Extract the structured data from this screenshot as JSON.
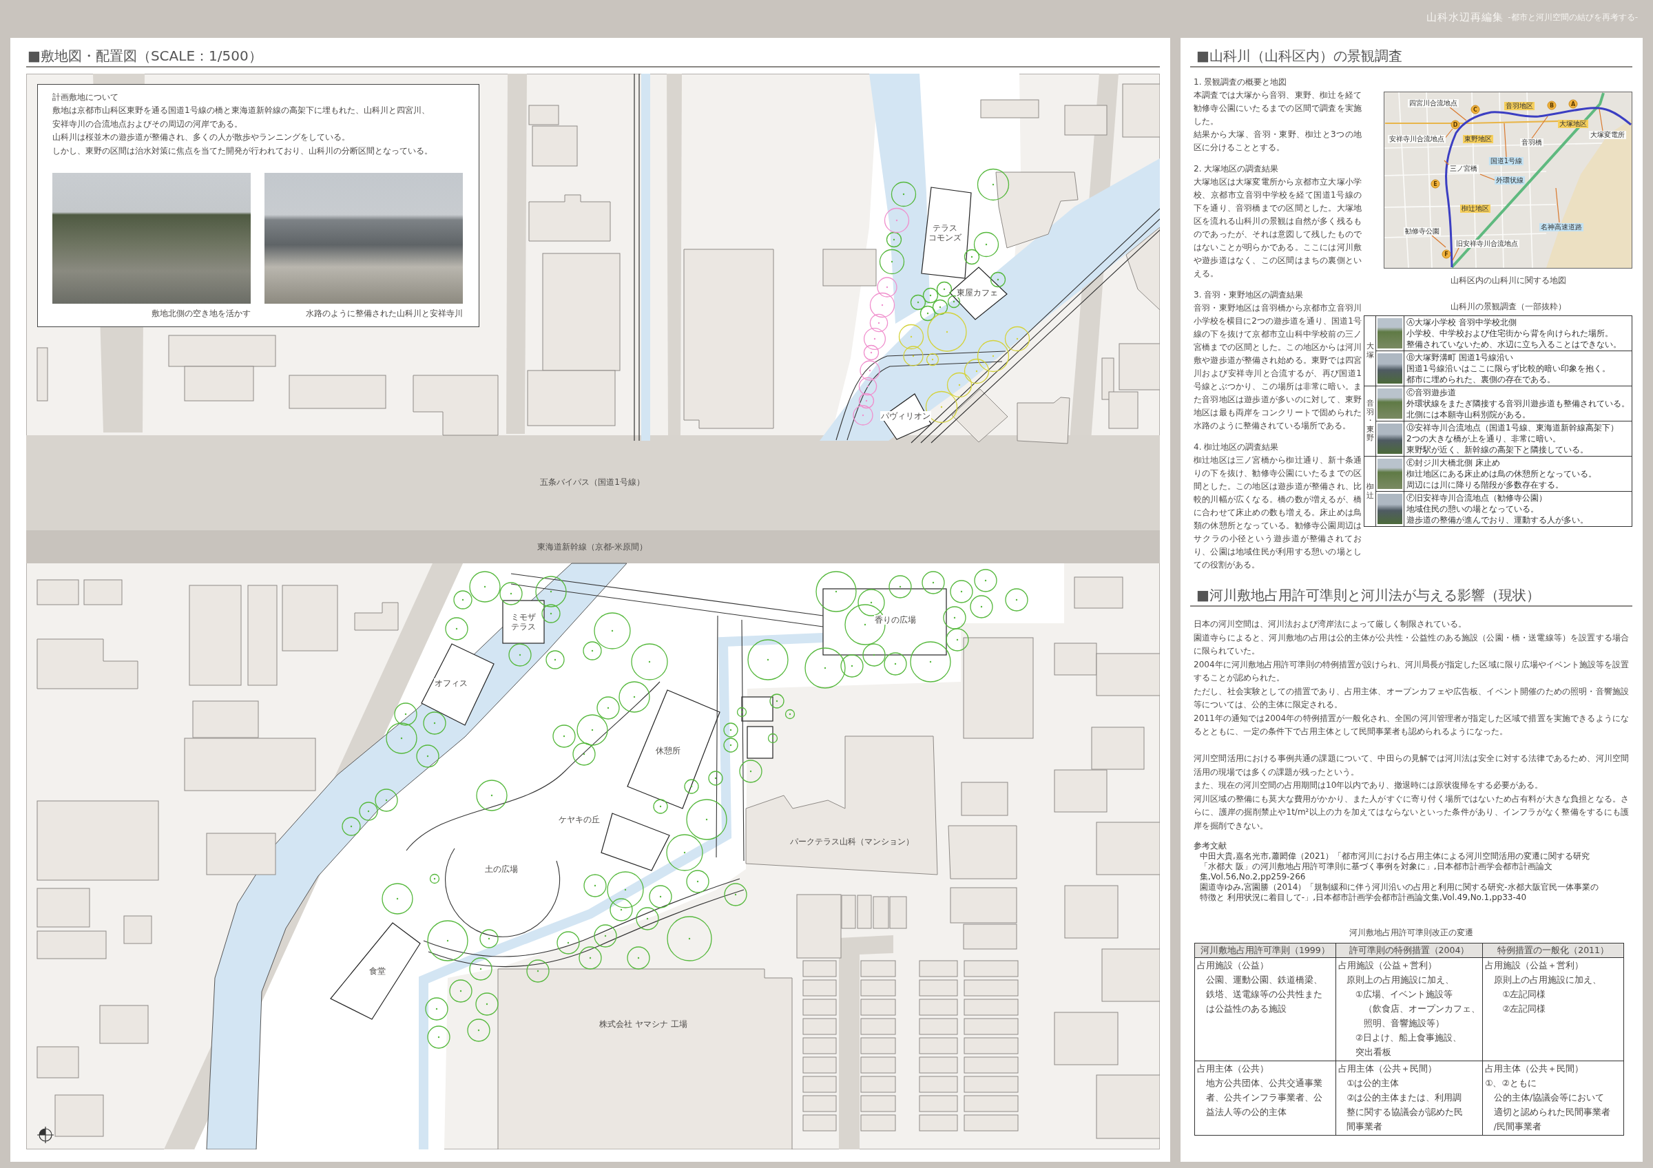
{
  "header": {
    "title": "山科水辺再編集",
    "subtitle": "-都市と河川空間の結びを再考する-"
  },
  "site_plan": {
    "heading": "■敷地図・配置図（SCALE：1/500）",
    "info_box": {
      "title": "計画敷地について",
      "paragraphs": [
        "敷地は京都市山科区東野を通る国道1号線の橋と東海道新幹線の高架下に埋もれた、山科川と四宮川、安祥寺川の合流地点およびその周辺の河岸である。",
        "山科川は桜並木の遊歩道が整備され、多くの人が散歩やランニングをしている。",
        "しかし、東野の区間は治水対策に焦点を当てた開発が行われており、山科川の分断区間となっている。"
      ],
      "photos": [
        {
          "caption": "敷地北側の空き地を活かす"
        },
        {
          "caption": "水路のように整備された山科川と安祥寺川"
        }
      ]
    },
    "map_labels": [
      {
        "lines": [
          "テラス",
          "コモンズ"
        ]
      },
      {
        "lines": [
          "東屋カフェ"
        ]
      },
      {
        "lines": [
          "パヴィリオン"
        ]
      },
      {
        "lines": [
          "五条バイパス（国道1号線）"
        ]
      },
      {
        "lines": [
          "東海道新幹線（京都-米原間）"
        ]
      },
      {
        "lines": [
          "ミモザ",
          "テラス"
        ]
      },
      {
        "lines": [
          "オフィス"
        ]
      },
      {
        "lines": [
          "香りの広場"
        ]
      },
      {
        "lines": [
          "休憩所"
        ]
      },
      {
        "lines": [
          "ケヤキの丘"
        ]
      },
      {
        "lines": [
          "土の広場"
        ]
      },
      {
        "lines": [
          "パークテラス山科（マンション）"
        ]
      },
      {
        "lines": [
          "食堂"
        ]
      },
      {
        "lines": [
          "株式会社 ヤマシナ 工場"
        ]
      }
    ]
  },
  "landscape_survey": {
    "heading": "■山科川（山科区内）の景観調査",
    "sections": [
      {
        "title": "1. 景観調査の概要と地図",
        "paragraphs": [
          "本調査では大塚から音羽、東野、椥辻を経て勧修寺公園にいたるまでの区間で調査を実施した。",
          "結果から大塚、音羽・東野、椥辻と3つの地区に分けることとする。"
        ]
      },
      {
        "title": "2. 大塚地区の調査結果",
        "paragraphs": [
          "大塚地区は大塚変電所から京都市立大塚小学校、京都市立音羽中学校を経て国道1号線の下を通り、音羽橋までの区間とした。大塚地区を流れる山科川の景観は自然が多く残るものであったが、それは意図して残したものではないことが明らかである。ここには河川敷や遊歩道はなく、この区間はまちの裏側といえる。"
        ]
      },
      {
        "title": "3. 音羽・東野地区の調査結果",
        "paragraphs": [
          "音羽・東野地区は音羽橋から京都市立音羽川小学校を横目に2つの遊歩道を通り、国道1号線の下を抜けて京都市立山科中学校前の三ノ宮橋までの区間とした。この地区からは河川敷や遊歩道が整備され始める。東野では四宮川および安祥寺川と合流するが、再び国道1号線とぶつかり、この場所は非常に暗い。また音羽地区は遊歩道が多いのに対して、東野地区は最も両岸をコンクリートで固められた水路のように整備されている場所である。"
        ]
      },
      {
        "title": "4. 椥辻地区の調査結果",
        "paragraphs": [
          "椥辻地区は三ノ宮橋から椥辻通り、新十条通りの下を抜け、勧修寺公園にいたるまでの区間とした。この地区は遊歩道が整備され、比較的川幅が広くなる。橋の数が増えるが、橋に合わせて床止めの数も増える。床止めは鳥類の休憩所となっている。勧修寺公園周辺はサクラの小径という遊歩道が整備されており、公園は地域住民が利用する憩いの場としての役割がある。"
        ]
      }
    ],
    "area_map": {
      "labels": [
        {
          "text": "四宮川合流地点",
          "kind": "place"
        },
        {
          "text": "音羽地区",
          "kind": "district"
        },
        {
          "text": "大塚地区",
          "kind": "district"
        },
        {
          "text": "大塚変電所",
          "kind": "place"
        },
        {
          "text": "東野地区",
          "kind": "district"
        },
        {
          "text": "安祥寺川合流地点",
          "kind": "place"
        },
        {
          "text": "音羽橋",
          "kind": "place"
        },
        {
          "text": "国道1号線",
          "kind": "road"
        },
        {
          "text": "三ノ宮橋",
          "kind": "place"
        },
        {
          "text": "外環状線",
          "kind": "road"
        },
        {
          "text": "椥辻地区",
          "kind": "district"
        },
        {
          "text": "名神高速道路",
          "kind": "road"
        },
        {
          "text": "勧修寺公園",
          "kind": "place"
        },
        {
          "text": "旧安祥寺川合流地点",
          "kind": "place"
        }
      ],
      "markers": [
        "A",
        "B",
        "C",
        "D",
        "E",
        "F"
      ],
      "caption": "山科区内の山科川に関する地図"
    },
    "survey_table": {
      "title": "山科川の景観調査（一部抜粋）",
      "groups": [
        {
          "name": "大塚",
          "rows": [
            {
              "title": "Ⓐ大塚小学校 音羽中学校北側",
              "notes": [
                "小学校、中学校および住宅街から背を向けられた場所。",
                "整備されていないため、水辺に立ち入ることはできない。"
              ]
            },
            {
              "title": "Ⓑ大塚野溝町 国道1号線沿い",
              "notes": [
                "国道1号線沿いはここに限らず比較的暗い印象を抱く。",
                "都市に埋められた、裏側の存在である。"
              ]
            }
          ]
        },
        {
          "name": "音羽・東野",
          "rows": [
            {
              "title": "Ⓒ音羽遊歩道",
              "notes": [
                "外環状線をまたぎ隣接する音羽川遊歩道も整備されている。",
                "北側には本願寺山科別院がある。"
              ]
            },
            {
              "title": "Ⓓ安祥寺川合流地点（国道1号線、東海道新幹線高架下）",
              "notes": [
                "2つの大きな橋が上を通り、非常に暗い。",
                "東野駅が近く、新幹線の高架下と隣接している。"
              ]
            }
          ]
        },
        {
          "name": "椥辻",
          "rows": [
            {
              "title": "Ⓔ封ジ川大橋北側 床止め",
              "notes": [
                "椥辻地区にある床止めは鳥の休憩所となっている。",
                "周辺には川に降りる階段が多数存在する。"
              ]
            },
            {
              "title": "Ⓕ旧安祥寺川合流地点（勧修寺公園）",
              "notes": [
                "地域住民の憩いの場となっている。",
                "遊歩道の整備が進んでおり、運動する人が多い。"
              ]
            }
          ]
        }
      ]
    }
  },
  "river_law": {
    "heading": "■河川敷地占用許可準則と河川法が与える影響（現状）",
    "paragraph_groups": [
      [
        "日本の河川空間は、河川法および湾岸法によって厳しく制限されている。",
        "園道寺らによると、河川敷地の占用は公的主体が公共性・公益性のある施設（公園・橋・送電線等）を設置する場合に限られていた。",
        "2004年に河川敷地占用許可準則の特例措置が設けられ、河川局長が指定した区域に限り広場やイベント施設等を設置することが認められた。",
        "ただし、社会実験としての措置であり、占用主体、オープンカフェや広告板、イベント開催のための照明・音響施設等については、公的主体に限定される。",
        "2011年の通知では2004年の特例措置が一般化され、全国の河川管理者が指定した区域で措置を実施できるようになるとともに、一定の条件下で占用主体として民間事業者も認められるようになった。"
      ],
      [
        "河川空間活用における事例共通の課題について、中田らの見解では河川法は安全に対する法律であるため、河川空間活用の現場では多くの課題が残ったという。",
        "また、現在の河川空間の占用期間は10年以内であり、撤退時には原状復帰をする必要がある。",
        "河川区域の整備にも莫大な費用がかかり、また人がすぐに寄り付く場所ではないため占有料が大きな負担となる。さらに、護岸の掘削禁止や1t/m²以上の力を加えてはならないといった条件があり、インフラがなく整備をするにも護岸を掘削できない。"
      ]
    ],
    "references": {
      "title": "参考文献",
      "items": [
        "中田大貴,嘉名光市,蕭閎偉（2021）「都市河川における占用主体による河川空間活用の変遷に関する研究「水都大 阪」の河川敷地占用許可準則に基づく事例を対象に」,日本都市計画学会都市計画論文集,Vol.56,No.2,pp259-266",
        "園道寺ゆみ,宮園勝（2014）「規制緩和に伴う河川沿いの占用と利用に関する研究-水都大阪官民一体事業の特徴と 利用状況に着目して-」,日本都市計画学会都市計画論文集,Vol.49,No.1,pp33-40"
      ]
    },
    "table": {
      "title": "河川敷地占用許可準則改正の変遷",
      "columns": [
        "河川敷地占用許可準則（1999）",
        "許可準則の特例措置（2004）",
        "特例措置の一般化（2011）"
      ],
      "rows": [
        [
          [
            {
              "lines": [
                "占用施設（公益）"
              ],
              "children": [
                {
                  "lines": [
                    "公園、運動公園、鉄道橋梁、",
                    "鉄塔、送電線等の公共性また",
                    "は公益性のある施設"
                  ]
                }
              ]
            }
          ],
          [
            {
              "lines": [
                "占用施設（公益＋営利）"
              ],
              "children": [
                {
                  "lines": [
                    "原則上の占用施設に加え、"
                  ],
                  "children": [
                    {
                      "lines": [
                        "①広場、イベント施設等"
                      ],
                      "children": [
                        {
                          "lines": [
                            "（飲食店、オープンカフェ、",
                            "照明、音響施設等）"
                          ]
                        }
                      ]
                    },
                    {
                      "lines": [
                        "②日よけ、船上食事施設、",
                        "突出看板"
                      ]
                    }
                  ]
                }
              ]
            }
          ],
          [
            {
              "lines": [
                "占用施設（公益＋営利）"
              ],
              "children": [
                {
                  "lines": [
                    "原則上の占用施設に加え、"
                  ],
                  "children": [
                    {
                      "lines": [
                        "①左記同様"
                      ]
                    },
                    {
                      "lines": [
                        "②左記同様"
                      ]
                    }
                  ]
                }
              ]
            }
          ]
        ],
        [
          [
            {
              "lines": [
                "占用主体（公共）"
              ],
              "children": [
                {
                  "lines": [
                    "地方公共団体、公共交通事業",
                    "者、公共インフラ事業者、公",
                    "益法人等の公的主体"
                  ]
                }
              ]
            }
          ],
          [
            {
              "lines": [
                "占用主体（公共＋民間）"
              ],
              "children": [
                {
                  "lines": [
                    "①は公的主体"
                  ]
                },
                {
                  "lines": [
                    "②は公的主体または、利用調",
                    "整に関する協議会が認めた民",
                    "間事業者"
                  ]
                }
              ]
            }
          ],
          [
            {
              "lines": [
                "占用主体（公共＋民間）"
              ]
            },
            {
              "lines": [
                "①、②ともに"
              ],
              "children": [
                {
                  "lines": [
                    "公的主体/協議会等において",
                    "適切と認められた民間事業者",
                    "/民間事業者"
                  ]
                }
              ]
            }
          ]
        ]
      ]
    }
  }
}
